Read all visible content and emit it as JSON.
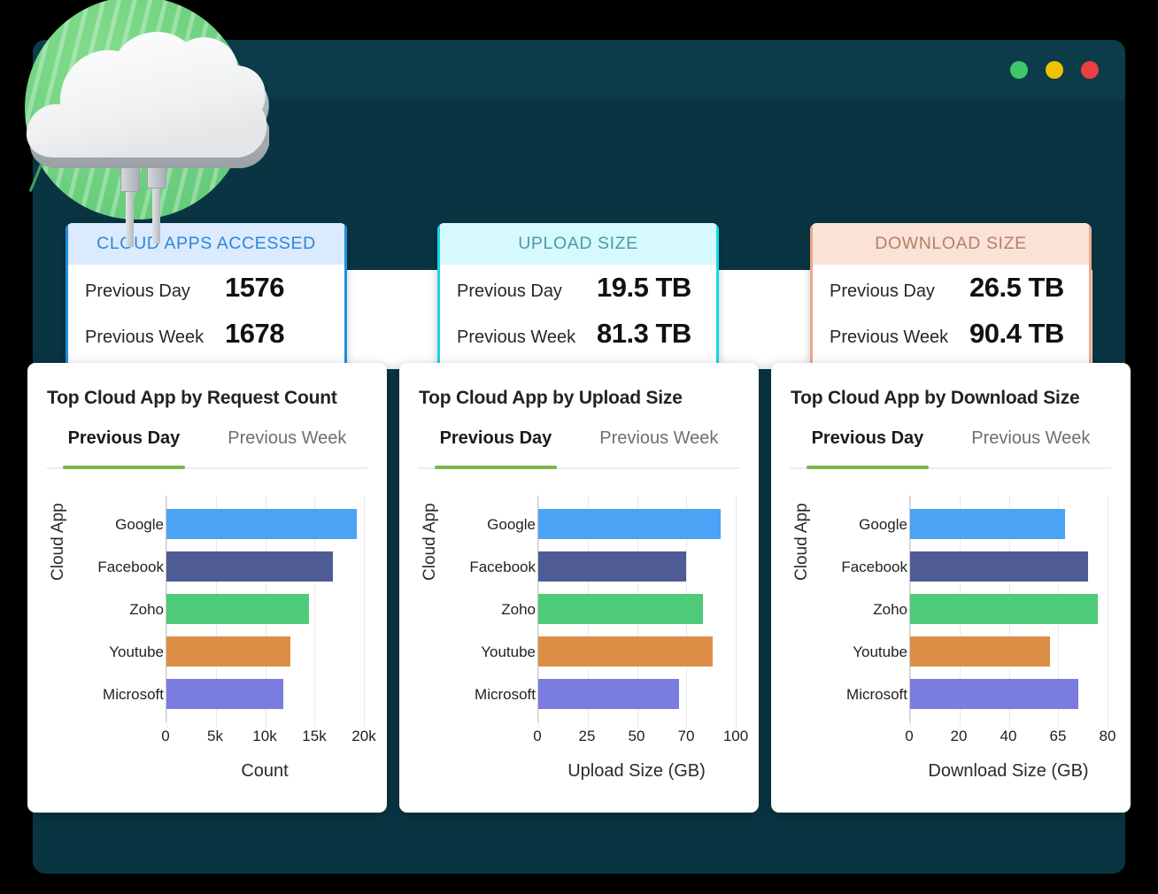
{
  "window": {
    "dots": [
      {
        "name": "minimize-dot",
        "color": "#3cc76a"
      },
      {
        "name": "maximize-dot",
        "color": "#f0c200"
      },
      {
        "name": "close-dot",
        "color": "#ea4040"
      }
    ]
  },
  "illustration": {
    "name": "cloud-connection-illustration",
    "circle_color": "#6ed080",
    "cloud_color": "#f3f4f5"
  },
  "stat_cards": [
    {
      "title": "CLOUD APPS ACCESSED",
      "accent": "#1e8fe0",
      "header_bg": "#dbeafe",
      "title_color": "#2f86d8",
      "rows": [
        {
          "label": "Previous Day",
          "value": "1576"
        },
        {
          "label": "Previous Week",
          "value": "1678"
        }
      ]
    },
    {
      "title": "UPLOAD SIZE",
      "accent": "#17d6e8",
      "header_bg": "#d6f9fd",
      "title_color": "#4b9aa6",
      "rows": [
        {
          "label": "Previous Day",
          "value": "19.5 TB"
        },
        {
          "label": "Previous Week",
          "value": "81.3 TB"
        }
      ]
    },
    {
      "title": "DOWNLOAD SIZE",
      "accent": "#e8a98e",
      "header_bg": "#fbe2d6",
      "title_color": "#b4806c",
      "rows": [
        {
          "label": "Previous Day",
          "value": "26.5 TB"
        },
        {
          "label": "Previous Week",
          "value": "90.4 TB"
        }
      ]
    }
  ],
  "chart_cards": [
    {
      "title": "Top Cloud App by Request Count",
      "tabs": [
        {
          "label": "Previous Day",
          "active": true
        },
        {
          "label": "Previous Week",
          "active": false
        }
      ]
    },
    {
      "title": "Top Cloud App by Upload Size",
      "tabs": [
        {
          "label": "Previous Day",
          "active": true
        },
        {
          "label": "Previous Week",
          "active": false
        }
      ]
    },
    {
      "title": "Top Cloud App by Download Size",
      "tabs": [
        {
          "label": "Previous Day",
          "active": true
        },
        {
          "label": "Previous Week",
          "active": false
        }
      ]
    }
  ],
  "chart_data": [
    {
      "type": "bar",
      "orientation": "horizontal",
      "title": "Top Cloud App by Request Count",
      "xlabel": "Count",
      "ylabel": "Cloud App",
      "categories": [
        "Google",
        "Facebook",
        "Zoho",
        "Youtube",
        "Microsoft"
      ],
      "values": [
        19300,
        16900,
        14400,
        12600,
        11800
      ],
      "colors": [
        "#4aa3f5",
        "#4f5b95",
        "#4ecb79",
        "#dd8e46",
        "#7b7ce0"
      ],
      "tick_labels": [
        "0",
        "5k",
        "10k",
        "15k",
        "20k"
      ],
      "tick_values": [
        0,
        5000,
        10000,
        15000,
        20000
      ],
      "xlim": [
        0,
        20000
      ],
      "grid": true,
      "legend": "none"
    },
    {
      "type": "bar",
      "orientation": "horizontal",
      "title": "Top Cloud App by Upload Size",
      "xlabel": "Upload Size (GB)",
      "ylabel": "Cloud App",
      "categories": [
        "Google",
        "Facebook",
        "Zoho",
        "Youtube",
        "Microsoft"
      ],
      "values": [
        91,
        70,
        80,
        86,
        67
      ],
      "colors": [
        "#4aa3f5",
        "#4f5b95",
        "#4ecb79",
        "#dd8e46",
        "#7b7ce0"
      ],
      "tick_labels": [
        "0",
        "25",
        "50",
        "70",
        "100"
      ],
      "tick_values": [
        0,
        25,
        50,
        70,
        100
      ],
      "xlim": [
        0,
        100
      ],
      "grid": true,
      "legend": "none"
    },
    {
      "type": "bar",
      "orientation": "horizontal",
      "title": "Top Cloud App by Download Size",
      "xlabel": "Download Size (GB)",
      "ylabel": "Cloud App",
      "categories": [
        "Google",
        "Facebook",
        "Zoho",
        "Youtube",
        "Microsoft"
      ],
      "values": [
        67,
        74,
        77,
        61,
        71
      ],
      "colors": [
        "#4aa3f5",
        "#4f5b95",
        "#4ecb79",
        "#dd8e46",
        "#7b7ce0"
      ],
      "tick_labels": [
        "0",
        "20",
        "40",
        "65",
        "80"
      ],
      "tick_values": [
        0,
        20,
        40,
        65,
        80
      ],
      "xlim": [
        0,
        80
      ],
      "grid": true,
      "legend": "none"
    }
  ]
}
